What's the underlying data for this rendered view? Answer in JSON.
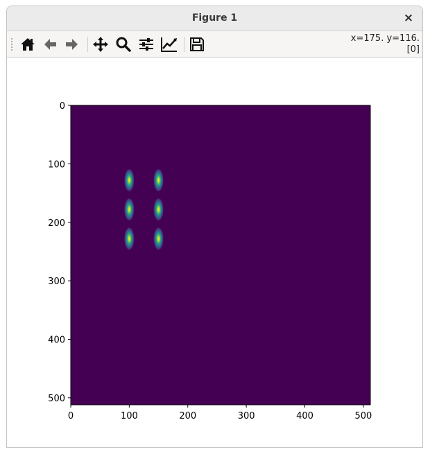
{
  "window": {
    "title": "Figure 1",
    "close_glyph": "×"
  },
  "toolbar": {
    "tools": [
      {
        "name": "home-icon",
        "tooltip": "Reset original view"
      },
      {
        "name": "back-arrow-icon",
        "tooltip": "Back to previous view"
      },
      {
        "name": "forward-arrow-icon",
        "tooltip": "Forward to next view"
      },
      {
        "name": "pan-icon",
        "tooltip": "Pan axes"
      },
      {
        "name": "zoom-icon",
        "tooltip": "Zoom to rectangle"
      },
      {
        "name": "configure-subplots-icon",
        "tooltip": "Configure subplots"
      },
      {
        "name": "edit-axis-icon",
        "tooltip": "Edit axis"
      },
      {
        "name": "save-icon",
        "tooltip": "Save the figure"
      }
    ],
    "coords_line1": "x=175. y=116.",
    "coords_line2": "[0]"
  },
  "chart_data": {
    "type": "heatmap",
    "title": "",
    "xlabel": "",
    "ylabel": "",
    "xlim": [
      0,
      512
    ],
    "ylim": [
      512,
      0
    ],
    "x_ticks": [
      0,
      100,
      200,
      300,
      400,
      500
    ],
    "y_ticks": [
      0,
      100,
      200,
      300,
      400,
      500
    ],
    "colormap": "viridis",
    "background_color": "#440154",
    "peaks": [
      {
        "x": 100,
        "y": 128
      },
      {
        "x": 100,
        "y": 178
      },
      {
        "x": 100,
        "y": 228
      },
      {
        "x": 150,
        "y": 128
      },
      {
        "x": 150,
        "y": 178
      },
      {
        "x": 150,
        "y": 228
      }
    ],
    "peak_sigma_x": 3.5,
    "peak_sigma_y": 10,
    "grid": false
  }
}
